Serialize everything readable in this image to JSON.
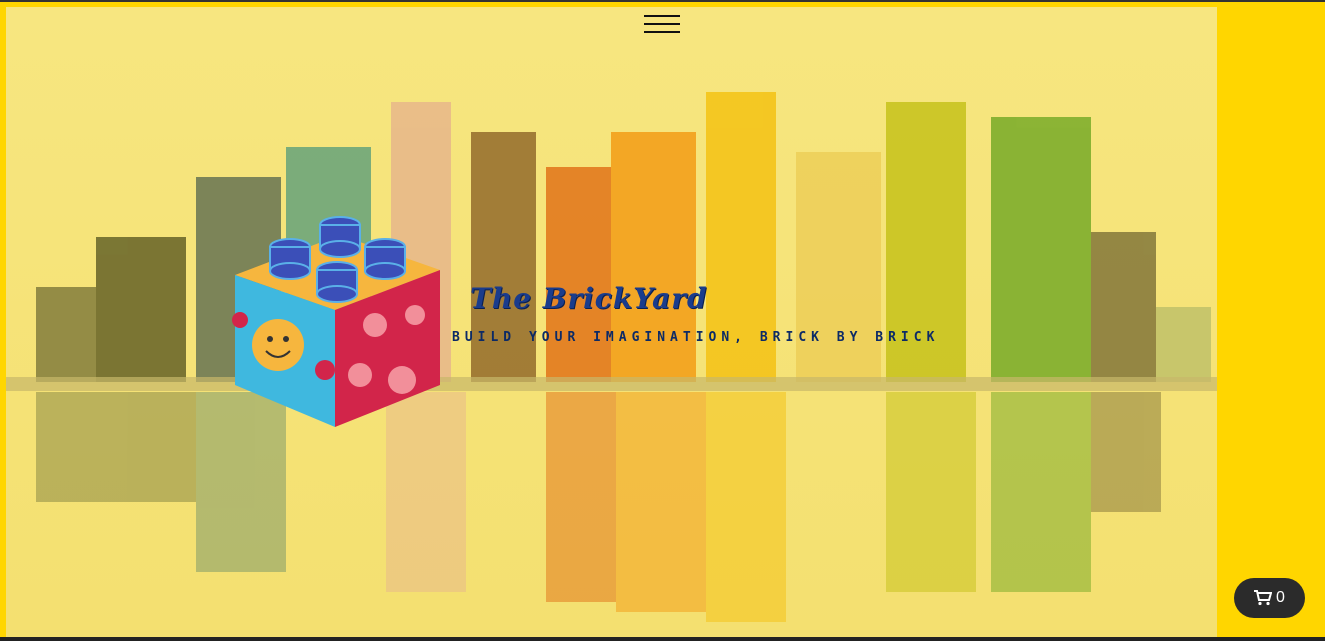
{
  "header": {
    "menu_icon": "hamburger-menu-icon"
  },
  "brand": {
    "title": "The BrickYard",
    "tagline": "BUILD YOUR IMAGINATION, BRICK BY BRICK",
    "logo_icon": "toy-brick-logo-icon"
  },
  "cart": {
    "icon": "shopping-cart-icon",
    "count": "0"
  },
  "colors": {
    "page_bg": "#ffd600",
    "cart_bg": "#2b2b2b",
    "title_color": "#1a3c8c"
  }
}
